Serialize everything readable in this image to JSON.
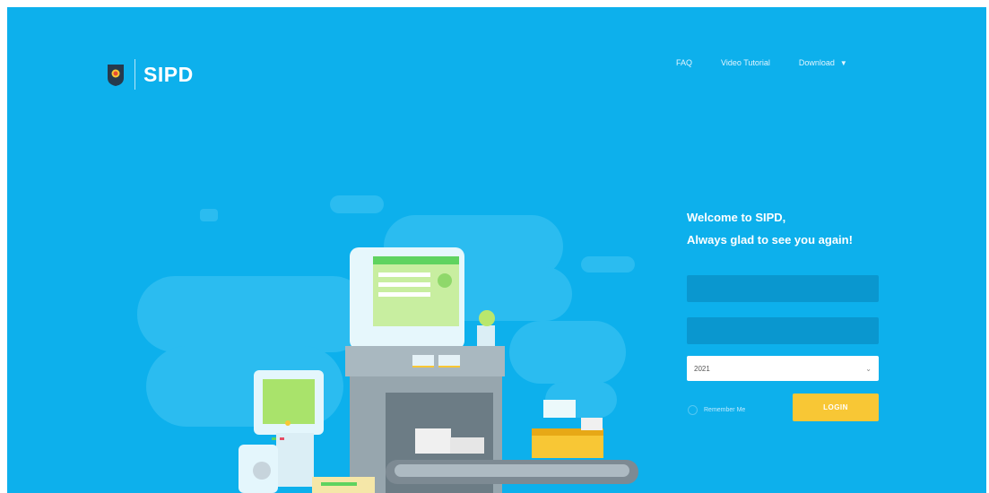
{
  "header": {
    "brand": "SIPD",
    "nav": {
      "faq": "FAQ",
      "video_tutorial": "Video Tutorial",
      "download": "Download"
    }
  },
  "login": {
    "welcome_line1": "Welcome to SIPD,",
    "welcome_line2": "Always glad to see you again!",
    "year_value": "2021",
    "remember_label": "Remember Me",
    "login_label": "LOGIN"
  },
  "colors": {
    "background": "#0db0ec",
    "input_background": "#0a97cf",
    "login_button": "#f8c735",
    "illustration_green": "#5fd35f"
  },
  "icons": [
    "emblem-logo-icon",
    "caret-down-icon",
    "chevron-down-icon"
  ]
}
